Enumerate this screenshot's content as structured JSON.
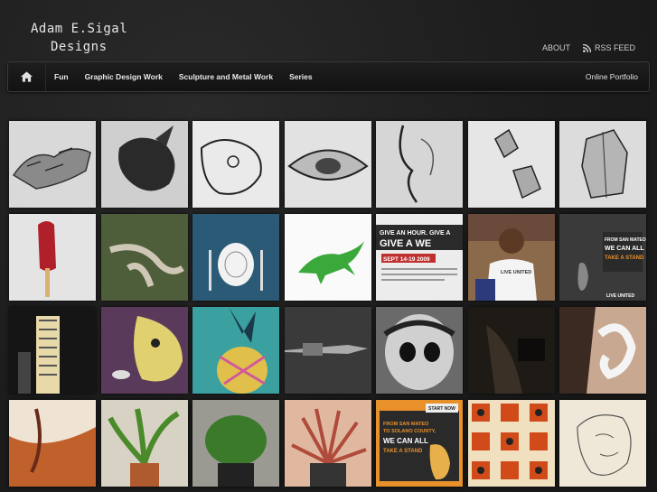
{
  "site": {
    "title_line1": "Adam E.Sigal",
    "title_line2": "Designs"
  },
  "top_links": {
    "about": "ABOUT",
    "rss": "RSS FEED"
  },
  "nav": {
    "items": [
      "Fun",
      "Graphic Design Work",
      "Sculpture and Metal Work",
      "Series"
    ],
    "right": "Online Portfolio"
  },
  "thumbnails": {
    "poster1": {
      "line1": "GIVE AN HOUR. GIVE A",
      "line2": "GIVE A WE",
      "line3": "SEPT 14-19 2009"
    },
    "photo_shirt": "LIVE UNITED",
    "poster2": {
      "line1": "FROM SAN MATEO",
      "line2": "WE CAN ALL",
      "line3": "TAKE A STAND",
      "footer": "LIVE UNITED"
    },
    "poster3": {
      "line1": "FROM SAN MATEO",
      "line2": "TO SOLANO COUNTY,",
      "line3": "WE CAN ALL",
      "line4": "TAKE A STAND",
      "tag": "START NOW"
    }
  },
  "colors": {
    "background": "#1f1f1f",
    "nav_bg": "#151515",
    "accent_orange": "#e8902a"
  }
}
